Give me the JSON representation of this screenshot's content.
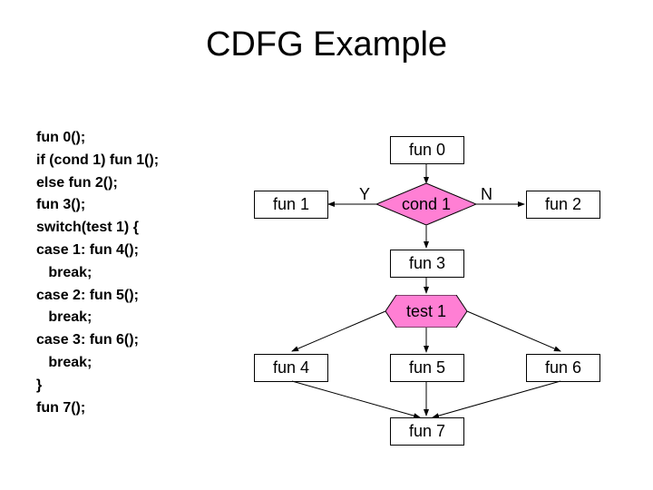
{
  "title": "CDFG Example",
  "code_lines": [
    "fun 0();",
    "if (cond 1) fun 1();",
    "else fun 2();",
    "fun 3();",
    "switch(test 1) {",
    "case 1: fun 4();",
    "   break;",
    "case 2: fun 5();",
    "   break;",
    "case 3: fun 6();",
    "   break;",
    "}",
    "fun 7();"
  ],
  "nodes": {
    "fun0": "fun 0",
    "fun1": "fun 1",
    "fun2": "fun 2",
    "fun3": "fun 3",
    "fun4": "fun 4",
    "fun5": "fun 5",
    "fun6": "fun 6",
    "fun7": "fun 7",
    "cond1": "cond 1",
    "test1": "test 1"
  },
  "edge_labels": {
    "yes": "Y",
    "no": "N"
  },
  "colors": {
    "diamond_fill": "#ff7fd4",
    "hex_fill": "#ff7fd4"
  }
}
